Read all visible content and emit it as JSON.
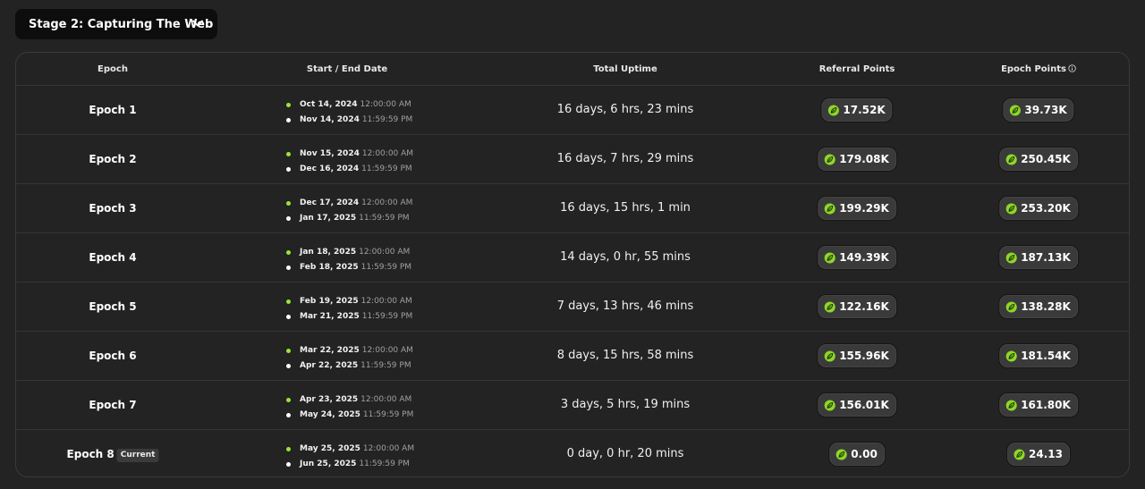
{
  "stage_selector": {
    "label": "Stage 2: Capturing The Web",
    "icon": "chevron-down-icon"
  },
  "table": {
    "headers": {
      "epoch": "Epoch",
      "dates": "Start / End Date",
      "uptime": "Total Uptime",
      "referral": "Referral Points",
      "epoch_points": "Epoch Points"
    },
    "current_badge": "Current",
    "colors": {
      "start_dot": "#9be33a",
      "end_dot": "#ffffff",
      "leaf": "#8fd628"
    },
    "rows": [
      {
        "epoch": "Epoch 1",
        "start_date": "Oct 14, 2024",
        "start_time": "12:00:00 AM",
        "end_date": "Nov 14, 2024",
        "end_time": "11:59:59 PM",
        "uptime": "16 days, 6 hrs, 23 mins",
        "referral": "17.52K",
        "points": "39.73K"
      },
      {
        "epoch": "Epoch 2",
        "start_date": "Nov 15, 2024",
        "start_time": "12:00:00 AM",
        "end_date": "Dec 16, 2024",
        "end_time": "11:59:59 PM",
        "uptime": "16 days, 7 hrs, 29 mins",
        "referral": "179.08K",
        "points": "250.45K"
      },
      {
        "epoch": "Epoch 3",
        "start_date": "Dec 17, 2024",
        "start_time": "12:00:00 AM",
        "end_date": "Jan 17, 2025",
        "end_time": "11:59:59 PM",
        "uptime": "16 days, 15 hrs, 1 min",
        "referral": "199.29K",
        "points": "253.20K"
      },
      {
        "epoch": "Epoch 4",
        "start_date": "Jan 18, 2025",
        "start_time": "12:00:00 AM",
        "end_date": "Feb 18, 2025",
        "end_time": "11:59:59 PM",
        "uptime": "14 days, 0 hr, 55 mins",
        "referral": "149.39K",
        "points": "187.13K"
      },
      {
        "epoch": "Epoch 5",
        "start_date": "Feb 19, 2025",
        "start_time": "12:00:00 AM",
        "end_date": "Mar 21, 2025",
        "end_time": "11:59:59 PM",
        "uptime": "7 days, 13 hrs, 46 mins",
        "referral": "122.16K",
        "points": "138.28K"
      },
      {
        "epoch": "Epoch 6",
        "start_date": "Mar 22, 2025",
        "start_time": "12:00:00 AM",
        "end_date": "Apr 22, 2025",
        "end_time": "11:59:59 PM",
        "uptime": "8 days, 15 hrs, 58 mins",
        "referral": "155.96K",
        "points": "181.54K"
      },
      {
        "epoch": "Epoch 7",
        "start_date": "Apr 23, 2025",
        "start_time": "12:00:00 AM",
        "end_date": "May 24, 2025",
        "end_time": "11:59:59 PM",
        "uptime": "3 days, 5 hrs, 19 mins",
        "referral": "156.01K",
        "points": "161.80K"
      },
      {
        "epoch": "Epoch 8",
        "current": true,
        "start_date": "May 25, 2025",
        "start_time": "12:00:00 AM",
        "end_date": "Jun 25, 2025",
        "end_time": "11:59:59 PM",
        "uptime": "0 day, 0 hr, 20 mins",
        "referral": "0.00",
        "points": "24.13"
      }
    ]
  }
}
